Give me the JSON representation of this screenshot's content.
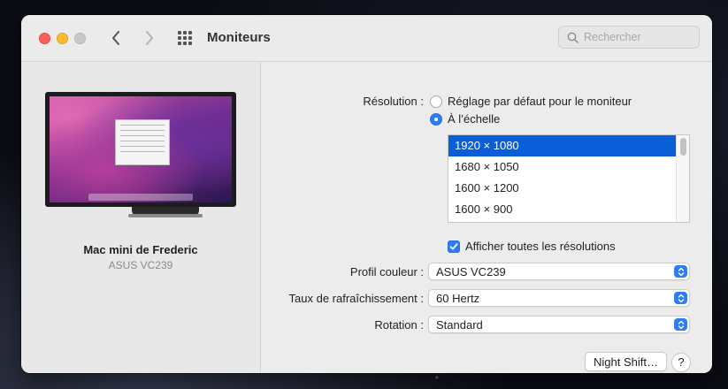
{
  "window": {
    "title": "Moniteurs",
    "search_placeholder": "Rechercher"
  },
  "device": {
    "name": "Mac mini de Frederic",
    "model": "ASUS VC239"
  },
  "resolution": {
    "label": "Résolution :",
    "options": [
      {
        "label": "Réglage par défaut pour le moniteur",
        "selected": false
      },
      {
        "label": "À l’échelle",
        "selected": true
      }
    ],
    "list": [
      "1920 × 1080",
      "1680 × 1050",
      "1600 × 1200",
      "1600 × 900"
    ],
    "selected_index": 0,
    "show_all_label": "Afficher toutes les résolutions",
    "show_all_checked": true
  },
  "color_profile": {
    "label": "Profil couleur :",
    "value": "ASUS VC239"
  },
  "refresh_rate": {
    "label": "Taux de rafraîchissement :",
    "value": "60 Hertz"
  },
  "rotation": {
    "label": "Rotation :",
    "value": "Standard"
  },
  "buttons": {
    "night_shift": "Night Shift…",
    "help": "?"
  },
  "colors": {
    "accent": "#2f7cf6",
    "selection": "#0a5fd8"
  }
}
